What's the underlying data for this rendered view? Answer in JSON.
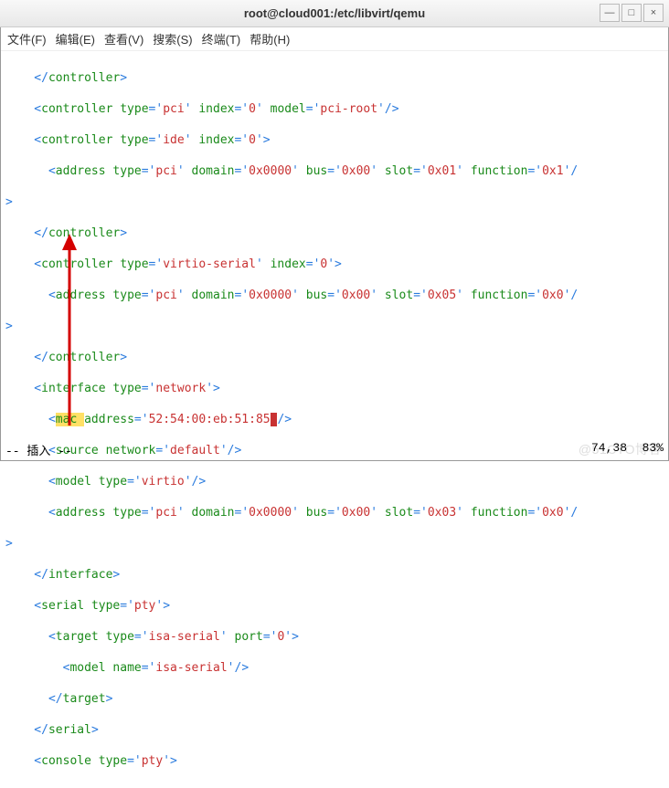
{
  "title": "root@cloud001:/etc/libvirt/qemu",
  "win": {
    "min": "—",
    "max": "□",
    "close": "×"
  },
  "menu": [
    "文件(F)",
    "编辑(E)",
    "查看(V)",
    "搜索(S)",
    "终端(T)",
    "帮助(H)"
  ],
  "L": {
    "t01": "    </",
    "t01a": "controller",
    "t01b": ">",
    "t02": "    <",
    "t02a": "controller ",
    "t02b": "type",
    "t02c": "='",
    "t02d": "pci",
    "t02e": "' ",
    "t02f": "index",
    "t02g": "='",
    "t02h": "0",
    "t02i": "' ",
    "t02j": "model",
    "t02k": "='",
    "t02l": "pci-root",
    "t02m": "'/>",
    "t03": "    <",
    "t03a": "controller ",
    "t03b": "type",
    "t03c": "='",
    "t03d": "ide",
    "t03e": "' ",
    "t03f": "index",
    "t03g": "='",
    "t03h": "0",
    "t03i": "'>",
    "t04": "      <",
    "t04a": "address ",
    "t04b": "type",
    "t04c": "='",
    "t04d": "pci",
    "t04e": "' ",
    "t04f": "domain",
    "t04g": "='",
    "t04h": "0x0000",
    "t04i": "' ",
    "t04j": "bus",
    "t04k": "='",
    "t04l": "0x00",
    "t04m": "' ",
    "t04n": "slot",
    "t04o": "='",
    "t04p": "0x01",
    "t04q": "' ",
    "t04r": "function",
    "t04s": "='",
    "t04t": "0x1",
    "t04u": "'/",
    "t05": ">",
    "t06": "    </",
    "t06a": "controller",
    "t06b": ">",
    "t07": "    <",
    "t07a": "controller ",
    "t07b": "type",
    "t07c": "='",
    "t07d": "virtio-serial",
    "t07e": "' ",
    "t07f": "index",
    "t07g": "='",
    "t07h": "0",
    "t07i": "'>",
    "t08": "      <",
    "t08a": "address ",
    "t08b": "type",
    "t08c": "='",
    "t08d": "pci",
    "t08e": "' ",
    "t08f": "domain",
    "t08g": "='",
    "t08h": "0x0000",
    "t08i": "' ",
    "t08j": "bus",
    "t08k": "='",
    "t08l": "0x00",
    "t08m": "' ",
    "t08n": "slot",
    "t08o": "='",
    "t08p": "0x05",
    "t08q": "' ",
    "t08r": "function",
    "t08s": "='",
    "t08t": "0x0",
    "t08u": "'/",
    "t09": ">",
    "t10": "    </",
    "t10a": "controller",
    "t10b": ">",
    "t11": "    <",
    "t11a": "interface ",
    "t11b": "type",
    "t11c": "='",
    "t11d": "network",
    "t11e": "'>",
    "t12": "      <",
    "t12a": "mac ",
    "t12b": "address",
    "t12c": "='",
    "t12d": "52:54:00:eb:51:85",
    "t12e": "'",
    "t12f": "/>",
    "t13": "      <",
    "t13a": "source ",
    "t13b": "network",
    "t13c": "='",
    "t13d": "default",
    "t13e": "'/>",
    "t14": "      <",
    "t14a": "model ",
    "t14b": "type",
    "t14c": "='",
    "t14d": "virtio",
    "t14e": "'/>",
    "t15": "      <",
    "t15a": "address ",
    "t15b": "type",
    "t15c": "='",
    "t15d": "pci",
    "t15e": "' ",
    "t15f": "domain",
    "t15g": "='",
    "t15h": "0x0000",
    "t15i": "' ",
    "t15j": "bus",
    "t15k": "='",
    "t15l": "0x00",
    "t15m": "' ",
    "t15n": "slot",
    "t15o": "='",
    "t15p": "0x03",
    "t15q": "' ",
    "t15r": "function",
    "t15s": "='",
    "t15t": "0x0",
    "t15u": "'/",
    "t16": ">",
    "t17": "    </",
    "t17a": "interface",
    "t17b": ">",
    "t18": "    <",
    "t18a": "serial ",
    "t18b": "type",
    "t18c": "='",
    "t18d": "pty",
    "t18e": "'>",
    "t19": "      <",
    "t19a": "target ",
    "t19b": "type",
    "t19c": "='",
    "t19d": "isa-serial",
    "t19e": "' ",
    "t19f": "port",
    "t19g": "='",
    "t19h": "0",
    "t19i": "'>",
    "t20": "        <",
    "t20a": "model ",
    "t20b": "name",
    "t20c": "='",
    "t20d": "isa-serial",
    "t20e": "'/>",
    "t21": "      </",
    "t21a": "target",
    "t21b": ">",
    "t22": "    </",
    "t22a": "serial",
    "t22b": ">",
    "t23": "    <",
    "t23a": "console ",
    "t23b": "type",
    "t23c": "='",
    "t23d": "pty",
    "t23e": "'>"
  },
  "status": {
    "mode": "-- 插入 --",
    "pos": "74,38",
    "pct": "83%"
  },
  "wm": "@51CTO博客"
}
